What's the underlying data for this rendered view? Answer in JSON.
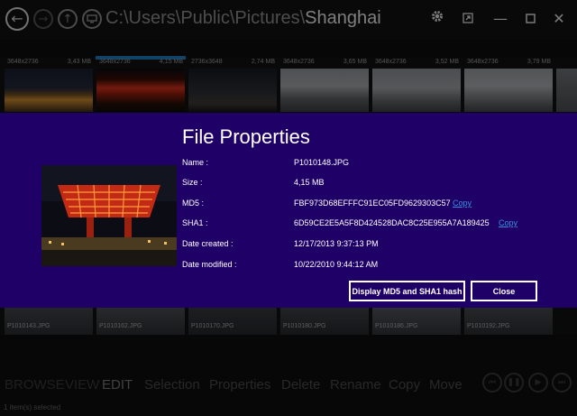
{
  "header": {
    "path_prefix": "C:\\Users\\Public\\Pictures\\",
    "path_current": "Shanghai"
  },
  "thumbnails_top": [
    {
      "dims": "3648x2736",
      "size": "3,43 MB"
    },
    {
      "dims": "3648x2736",
      "size": "4,15 MB"
    },
    {
      "dims": "2736x3648",
      "size": "2,74 MB"
    },
    {
      "dims": "3648x2736",
      "size": "3,65 MB"
    },
    {
      "dims": "3648x2736",
      "size": "3,52 MB"
    },
    {
      "dims": "3648x2736",
      "size": "3,79 MB"
    }
  ],
  "thumbnails_bottom": [
    {
      "name": "P1010143.JPG"
    },
    {
      "name": "P1010162.JPG"
    },
    {
      "name": "P1010170.JPG"
    },
    {
      "name": "P1010180.JPG"
    },
    {
      "name": "P1010186.JPG"
    },
    {
      "name": "P1010192.JPG"
    }
  ],
  "dialog": {
    "title": "File Properties",
    "labels": {
      "name": "Name :",
      "size": "Size :",
      "md5": "MD5 :",
      "sha1": "SHA1 :",
      "created": "Date created :",
      "modified": "Date modified :"
    },
    "values": {
      "name": "P1010148.JPG",
      "size": "4,15 MB",
      "md5": "FBF973D68EFFFC91EC05FD9629303C57",
      "sha1": "6D59CE2E5A5F8D424528DAC8C25E955A7A189425",
      "created": "12/17/2013 9:37:13 PM",
      "modified": "10/22/2010 9:44:12 AM"
    },
    "copy_label": "Copy",
    "hash_button": "Display MD5 and SHA1 hash",
    "close_button": "Close"
  },
  "bottom": {
    "modes": [
      "BROWSE",
      "VIEW",
      "EDIT"
    ],
    "actions": [
      "Selection",
      "Properties",
      "Delete",
      "Rename",
      "Copy",
      "Move"
    ],
    "status": "1 item(s) selected"
  },
  "colors": {
    "dialog_bg": "#1f0066",
    "selection": "#1e7bbf",
    "link": "#3d8fe0"
  }
}
